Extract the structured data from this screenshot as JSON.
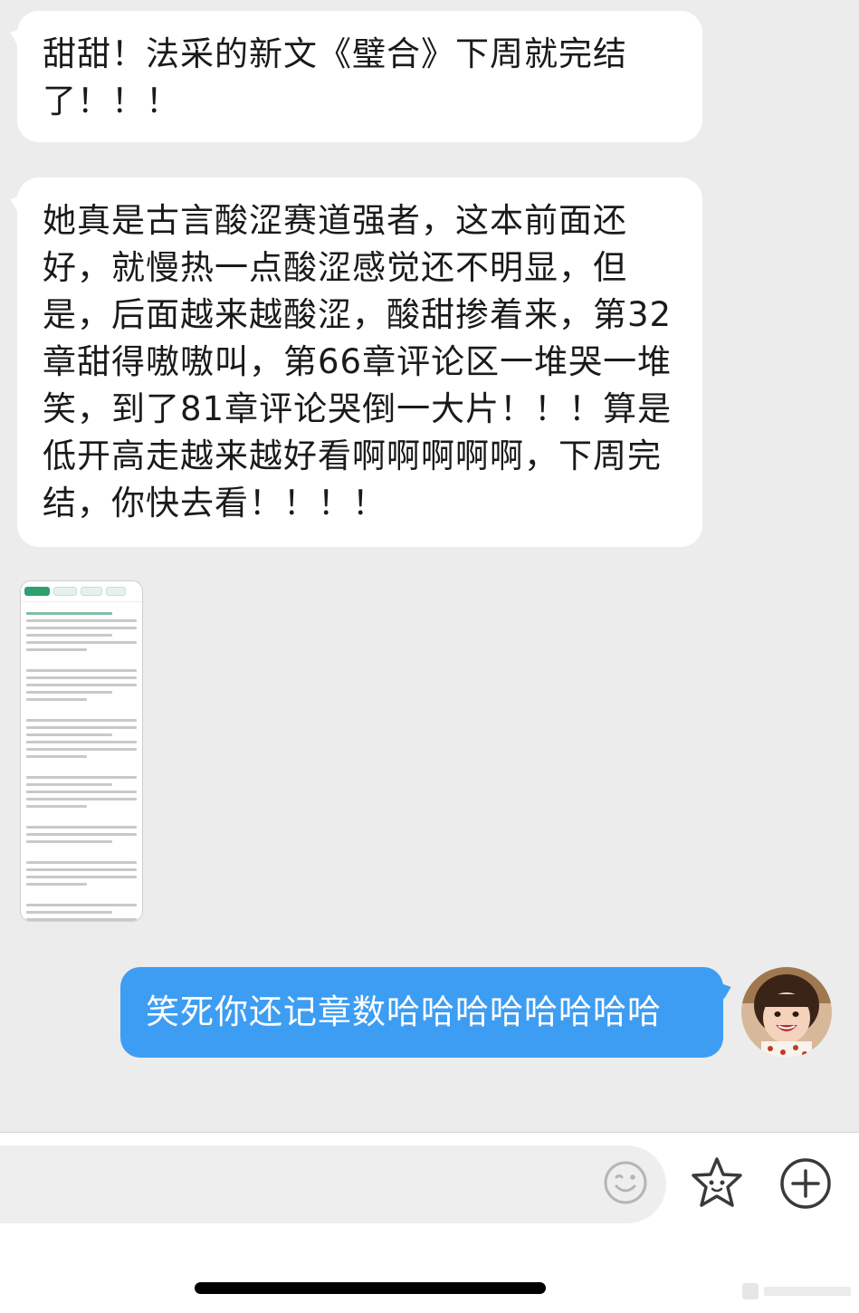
{
  "messages": {
    "incoming_1": "甜甜！法采的新文《璧合》下周就完结了！！！",
    "incoming_2": "她真是古言酸涩赛道强者，这本前面还好，就慢热一点酸涩感觉还不明显，但是，后面越来越酸涩，酸甜掺着来，第32章甜得嗷嗷叫，第66章评论区一堆哭一堆笑，到了81章评论哭倒一大片！！！算是低开高走越来越好看啊啊啊啊啊，下周完结，你快去看！！！！",
    "outgoing_1": "笑死你还记章数哈哈哈哈哈哈哈哈"
  },
  "image_message": {
    "icon": "novel-screenshot-thumbnail"
  },
  "input_bar": {
    "placeholder": "",
    "emoji_icon": "smiley-face-icon",
    "sticker_icon": "star-sticker-icon",
    "more_icon": "plus-circle-icon"
  },
  "colors": {
    "background": "#ececec",
    "incoming_bubble": "#ffffff",
    "outgoing_bubble": "#3d9df3",
    "accent_green": "#2e9f6e"
  }
}
